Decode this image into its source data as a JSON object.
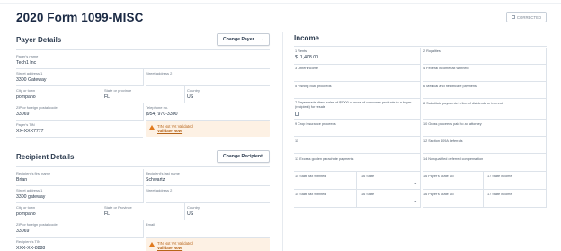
{
  "page_title": "2020 Form 1099-MISC",
  "corrected_label": "CORRECTED",
  "payer": {
    "section_title": "Payer Details",
    "change_button": "Change Payer",
    "name_label": "Payer's name",
    "name_value": "Tech1 Inc",
    "street1_label": "Street address 1",
    "street1_value": "3300 Gateway",
    "street2_label": "Street address 2",
    "street2_value": "",
    "city_label": "City or town",
    "city_value": "pompano",
    "state_label": "State or province",
    "state_value": "FL",
    "country_label": "Country",
    "country_value": "US",
    "zip_label": "ZIP or foreign postal code",
    "zip_value": "33069",
    "phone_label": "Telephone no.",
    "phone_value": "(954) 970-3300",
    "tin_label": "Payer's TIN",
    "tin_value": "XX-XXX7777",
    "warn_text": "TIN Not Yet Validated",
    "warn_link": "Validate Now"
  },
  "recipient": {
    "section_title": "Recipient Details",
    "change_button": "Change Recipient",
    "first_label": "Recipient's first name",
    "first_value": "Brian",
    "last_label": "Recipient's last name",
    "last_value": "Schwartz",
    "street1_label": "Street address 1",
    "street1_value": "3300 gateway",
    "street2_label": "Street address 2",
    "street2_value": "",
    "city_label": "City or town",
    "city_value": "pompano",
    "state_label": "State or Province",
    "state_value": "FL",
    "country_label": "Country",
    "country_value": "US",
    "zip_label": "ZIP or foreign postal code",
    "zip_value": "33069",
    "email_label": "Email",
    "email_value": "",
    "tin_label": "Recipient's TIN",
    "tin_value": "XXX-XX-8888",
    "warn_text": "TIN Not Yet Validated",
    "warn_link": "Validate Now"
  },
  "income": {
    "section_title": "Income",
    "box1_label": "1 Rents",
    "box1_currency": "$",
    "box1_value": "1,478.00",
    "box2_label": "2 Royalties",
    "box3_label": "3 Other income",
    "box4_label": "4 Federal income tax withheld",
    "box5_label": "5 Fishing boat proceeds",
    "box6_label": "6 Medical and healthcare payments",
    "box7_label": "7 Payer made direct sales of $5000 or more of consumer products to a buyer (recipient) for resale",
    "box8_label": "8 Substitute payments in lieu of dividends or interest",
    "box9_label": "9 Crop insurance proceeds",
    "box10_label": "10 Gross proceeds paid to an attorney",
    "box11_label": "11",
    "box12_label": "12 Section 409A deferrals",
    "box13_label": "13 Excess golden parachute payments",
    "box14_label": "14 Nonqualified deferred compensation",
    "box15a_label": "15 State tax withheld",
    "box16a_label": "16 State",
    "box16b_label": "16 Payer's State No",
    "box17a_label": "17 State income",
    "box15b_label": "15 State tax withheld",
    "box16c_label": "16 State",
    "box16d_label": "16 Payer's State No",
    "box17b_label": "17 State income"
  }
}
